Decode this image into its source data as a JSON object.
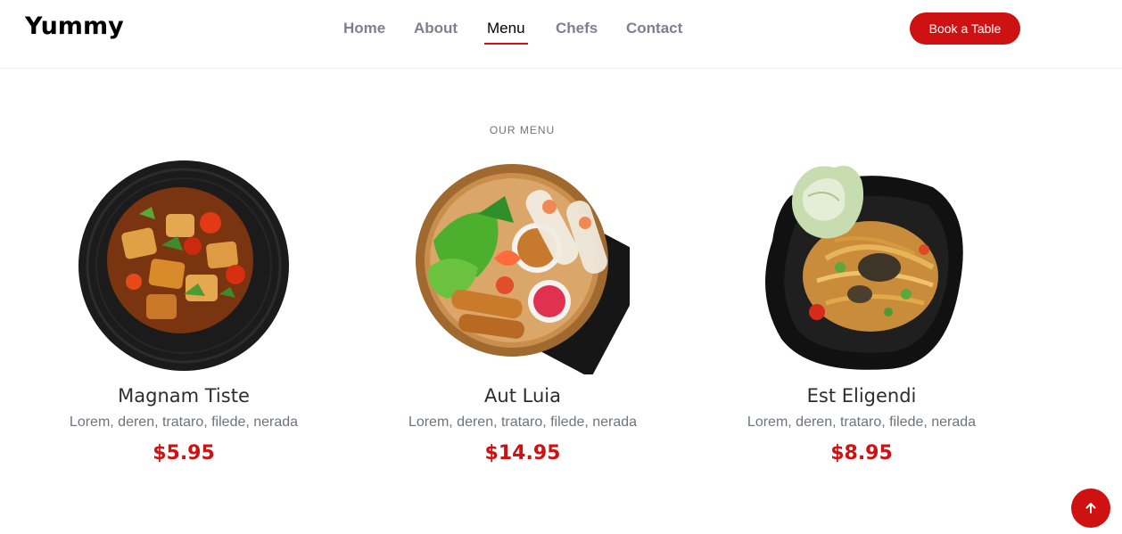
{
  "header": {
    "logo": "Yummy",
    "nav": [
      {
        "label": "Home",
        "active": false
      },
      {
        "label": "About",
        "active": false
      },
      {
        "label": "Menu",
        "active": true
      },
      {
        "label": "Chefs",
        "active": false
      },
      {
        "label": "Contact",
        "active": false
      }
    ],
    "cta_label": "Book a Table"
  },
  "menu": {
    "section_label": "OUR MENU",
    "items": [
      {
        "name": "Magnam Tiste",
        "description": "Lorem, deren, trataro, filede, nerada",
        "price": "$5.95"
      },
      {
        "name": "Aut Luia",
        "description": "Lorem, deren, trataro, filede, nerada",
        "price": "$14.95"
      },
      {
        "name": "Est Eligendi",
        "description": "Lorem, deren, trataro, filede, nerada",
        "price": "$8.95"
      }
    ]
  },
  "colors": {
    "accent": "#ce1212",
    "nav_text": "#7f7f90",
    "muted": "#6c757d"
  },
  "icons": {
    "scroll_top": "arrow-up-icon"
  }
}
